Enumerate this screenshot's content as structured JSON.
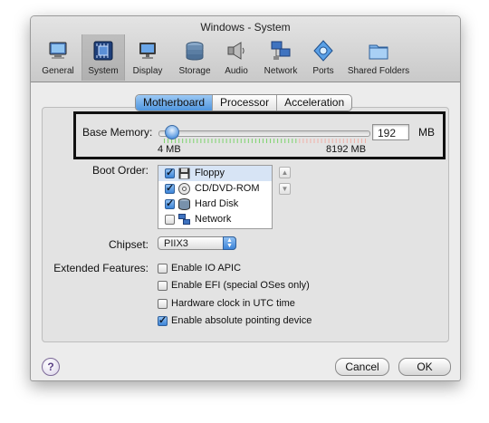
{
  "window": {
    "title": "Windows - System"
  },
  "toolbar": {
    "items": [
      {
        "label": "General",
        "icon": "monitor-icon"
      },
      {
        "label": "System",
        "icon": "chip-icon",
        "selected": true
      },
      {
        "label": "Display",
        "icon": "display-icon"
      },
      {
        "label": "Storage",
        "icon": "disk-stack-icon"
      },
      {
        "label": "Audio",
        "icon": "speaker-icon"
      },
      {
        "label": "Network",
        "icon": "network-icon"
      },
      {
        "label": "Ports",
        "icon": "ports-icon"
      },
      {
        "label": "Shared Folders",
        "icon": "folder-icon"
      }
    ]
  },
  "tabs": [
    {
      "label": "Motherboard",
      "active": true
    },
    {
      "label": "Processor"
    },
    {
      "label": "Acceleration"
    }
  ],
  "base_memory": {
    "label": "Base Memory:",
    "value": "192",
    "unit": "MB",
    "min_label": "4 MB",
    "max_label": "8192 MB",
    "min_mb": 4,
    "max_mb": 8192,
    "current_mb": 192
  },
  "boot_order": {
    "label": "Boot Order:",
    "items": [
      {
        "label": "Floppy",
        "checked": true,
        "icon": "floppy-icon"
      },
      {
        "label": "CD/DVD-ROM",
        "checked": true,
        "icon": "cd-icon"
      },
      {
        "label": "Hard Disk",
        "checked": true,
        "icon": "hard-disk-icon"
      },
      {
        "label": "Network",
        "checked": false,
        "icon": "network-card-icon"
      }
    ]
  },
  "chipset": {
    "label": "Chipset:",
    "value": "PIIX3"
  },
  "extended_features": {
    "label": "Extended Features:",
    "items": [
      {
        "label": "Enable IO APIC",
        "checked": false
      },
      {
        "label": "Enable EFI (special OSes only)",
        "checked": false
      },
      {
        "label": "Hardware clock in UTC time",
        "checked": false
      },
      {
        "label": "Enable absolute pointing device",
        "checked": true
      }
    ]
  },
  "buttons": {
    "help": "?",
    "cancel": "Cancel",
    "ok": "OK"
  },
  "colors": {
    "accent": "#3c84d8",
    "safe_range": "#7ed36e",
    "warn_range": "#f0b0a8"
  }
}
